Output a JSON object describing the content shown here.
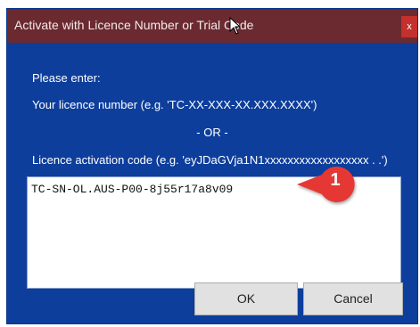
{
  "window": {
    "title": "Activate with Licence Number or Trial Code",
    "close_label": "x"
  },
  "dialog": {
    "prompt": "Please enter:",
    "licence_hint": "Your licence number (e.g. 'TC-XX-XXX-XX.XXX.XXXX')",
    "or_separator": "- OR -",
    "activation_hint": "Licence activation code (e.g. 'eyJDaGVja1N1xxxxxxxxxxxxxxxxxx . .')",
    "code_input_value": "TC-SN-OL.AUS-P00-8j55r17a8v09"
  },
  "buttons": {
    "ok_label": "OK",
    "cancel_label": "Cancel"
  },
  "callout": {
    "number": "1",
    "color": "#e53935"
  },
  "colors": {
    "titlebar": "#6b2a30",
    "dialog_bg": "#0d3e9c"
  }
}
